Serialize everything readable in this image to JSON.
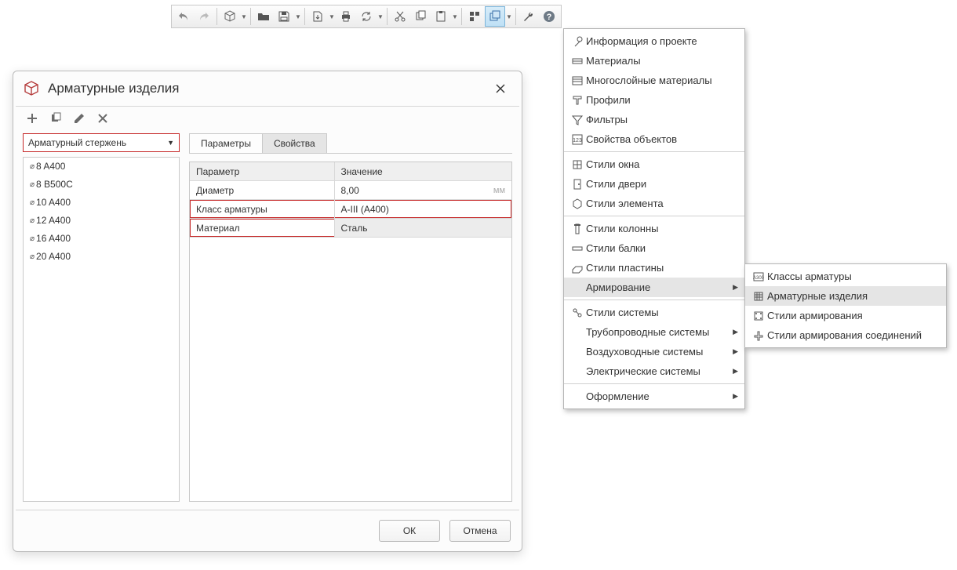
{
  "toolbar": {
    "icons": [
      "undo",
      "redo",
      "|",
      "cube-dd",
      "|",
      "folder",
      "save",
      "|",
      "export-dd",
      "print",
      "refresh",
      "|",
      "cut",
      "copy",
      "paste-dd",
      "|",
      "align",
      "windows-dd",
      "|",
      "wrench",
      "help"
    ]
  },
  "menu": {
    "sections": [
      [
        {
          "icon": "info",
          "label": "Информация о проекте"
        },
        {
          "icon": "materials",
          "label": "Материалы"
        },
        {
          "icon": "layers",
          "label": "Многослойные материалы"
        },
        {
          "icon": "profiles",
          "label": "Профили"
        },
        {
          "icon": "filter",
          "label": "Фильтры"
        },
        {
          "icon": "props",
          "label": "Свойства объектов"
        }
      ],
      [
        {
          "icon": "window",
          "label": "Стили окна"
        },
        {
          "icon": "door",
          "label": "Стили двери"
        },
        {
          "icon": "element",
          "label": "Стили элемента"
        }
      ],
      [
        {
          "icon": "column",
          "label": "Стили колонны"
        },
        {
          "icon": "beam",
          "label": "Стили балки"
        },
        {
          "icon": "plate",
          "label": "Стили пластины"
        },
        {
          "icon": "",
          "label": "Армирование",
          "sub": true,
          "hover": true
        }
      ],
      [
        {
          "icon": "system",
          "label": "Стили системы"
        },
        {
          "icon": "",
          "label": "Трубопроводные системы",
          "sub": true
        },
        {
          "icon": "",
          "label": "Воздуховодные системы",
          "sub": true
        },
        {
          "icon": "",
          "label": "Электрические системы",
          "sub": true
        }
      ],
      [
        {
          "icon": "",
          "label": "Оформление",
          "sub": true
        }
      ]
    ]
  },
  "submenu": {
    "items": [
      {
        "icon": "class",
        "label": "Классы арматуры"
      },
      {
        "icon": "grid",
        "label": "Арматурные изделия",
        "hover": true
      },
      {
        "icon": "rebarstyle",
        "label": "Стили армирования"
      },
      {
        "icon": "joint",
        "label": "Стили армирования соединений"
      }
    ]
  },
  "dialog": {
    "title": "Арматурные изделия",
    "type_select": "Арматурный стержень",
    "list": [
      "8 A400",
      "8 B500C",
      "10 A400",
      "12 A400",
      "16 A400",
      "20 A400"
    ],
    "tabs": {
      "parameters": "Параметры",
      "properties": "Свойства",
      "active": "properties"
    },
    "grid": {
      "header_key": "Параметр",
      "header_val": "Значение",
      "rows": [
        {
          "key": "Диаметр",
          "val": "8,00",
          "unit": "мм"
        },
        {
          "key": "Класс арматуры",
          "val": "A-III (A400)",
          "hl": true
        },
        {
          "key": "Материал",
          "val": "Сталь",
          "hl": true,
          "editing": true
        }
      ]
    },
    "ok": "ОК",
    "cancel": "Отмена"
  }
}
